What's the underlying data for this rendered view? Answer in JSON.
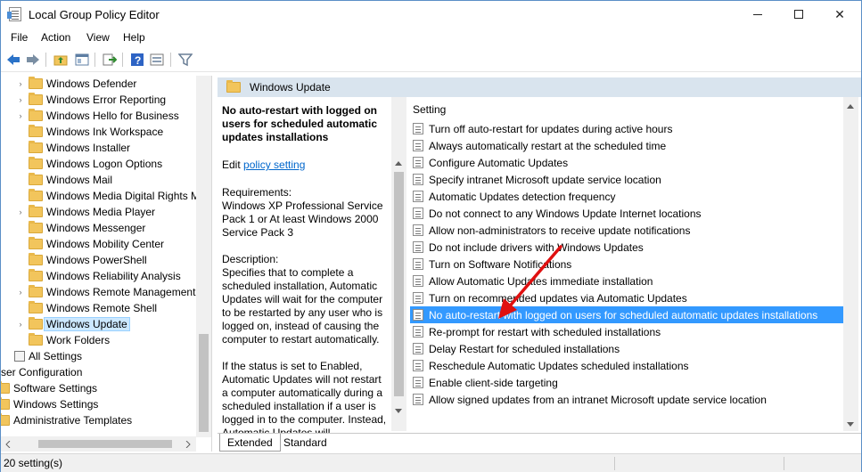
{
  "window": {
    "title": "Local Group Policy Editor"
  },
  "menu": [
    "File",
    "Action",
    "View",
    "Help"
  ],
  "tree": {
    "items": [
      {
        "label": "Windows Defender",
        "expander": "›"
      },
      {
        "label": "Windows Error Reporting",
        "expander": "›"
      },
      {
        "label": "Windows Hello for Business",
        "expander": "›"
      },
      {
        "label": "Windows Ink Workspace",
        "expander": ""
      },
      {
        "label": "Windows Installer",
        "expander": ""
      },
      {
        "label": "Windows Logon Options",
        "expander": ""
      },
      {
        "label": "Windows Mail",
        "expander": ""
      },
      {
        "label": "Windows Media Digital Rights M",
        "expander": ""
      },
      {
        "label": "Windows Media Player",
        "expander": "›"
      },
      {
        "label": "Windows Messenger",
        "expander": ""
      },
      {
        "label": "Windows Mobility Center",
        "expander": ""
      },
      {
        "label": "Windows PowerShell",
        "expander": ""
      },
      {
        "label": "Windows Reliability Analysis",
        "expander": ""
      },
      {
        "label": "Windows Remote Management",
        "expander": "›"
      },
      {
        "label": "Windows Remote Shell",
        "expander": ""
      },
      {
        "label": "Windows Update",
        "expander": "›",
        "selected": true
      },
      {
        "label": "Work Folders",
        "expander": ""
      },
      {
        "label": "All Settings",
        "expander": ""
      },
      {
        "label": "ser Configuration",
        "expander": ""
      },
      {
        "label": "Software Settings",
        "expander": ""
      },
      {
        "label": "Windows Settings",
        "expander": ""
      },
      {
        "label": "Administrative Templates",
        "expander": ""
      }
    ]
  },
  "right": {
    "header": "Windows Update",
    "description": {
      "title": "No auto-restart with logged on users for scheduled automatic updates installations",
      "edit_prefix": "Edit",
      "edit_link": "policy setting",
      "requirements_label": "Requirements:",
      "requirements": "Windows XP Professional Service Pack 1 or At least Windows 2000 Service Pack 3",
      "description_label": "Description:",
      "description": "Specifies that to complete a scheduled installation, Automatic Updates will wait for the computer to be restarted by any user who is logged on, instead of causing the computer to restart automatically.",
      "status_text": "If the status is set to Enabled, Automatic Updates will not restart a computer automatically during a scheduled installation if a user is logged in to the computer. Instead, Automatic Updates will"
    },
    "settings_header": "Setting",
    "settings": [
      "Turn off auto-restart for updates during active hours",
      "Always automatically restart at the scheduled time",
      "Configure Automatic Updates",
      "Specify intranet Microsoft update service location",
      "Automatic Updates detection frequency",
      "Do not connect to any Windows Update Internet locations",
      "Allow non-administrators to receive update notifications",
      "Do not include drivers with Windows Updates",
      "Turn on Software Notifications",
      "Allow Automatic Updates immediate installation",
      "Turn on recommended updates via Automatic Updates",
      "No auto-restart with logged on users for scheduled automatic updates installations",
      "Re-prompt for restart with scheduled installations",
      "Delay Restart for scheduled installations",
      "Reschedule Automatic Updates scheduled installations",
      "Enable client-side targeting",
      "Allow signed updates from an intranet Microsoft update service location"
    ],
    "selected_setting_index": 11
  },
  "tabs": [
    "Extended",
    "Standard"
  ],
  "status": "20 setting(s)",
  "colors": {
    "selection": "#3399ff",
    "tree_selection": "#cce8ff",
    "annotation_arrow": "#e01010"
  }
}
